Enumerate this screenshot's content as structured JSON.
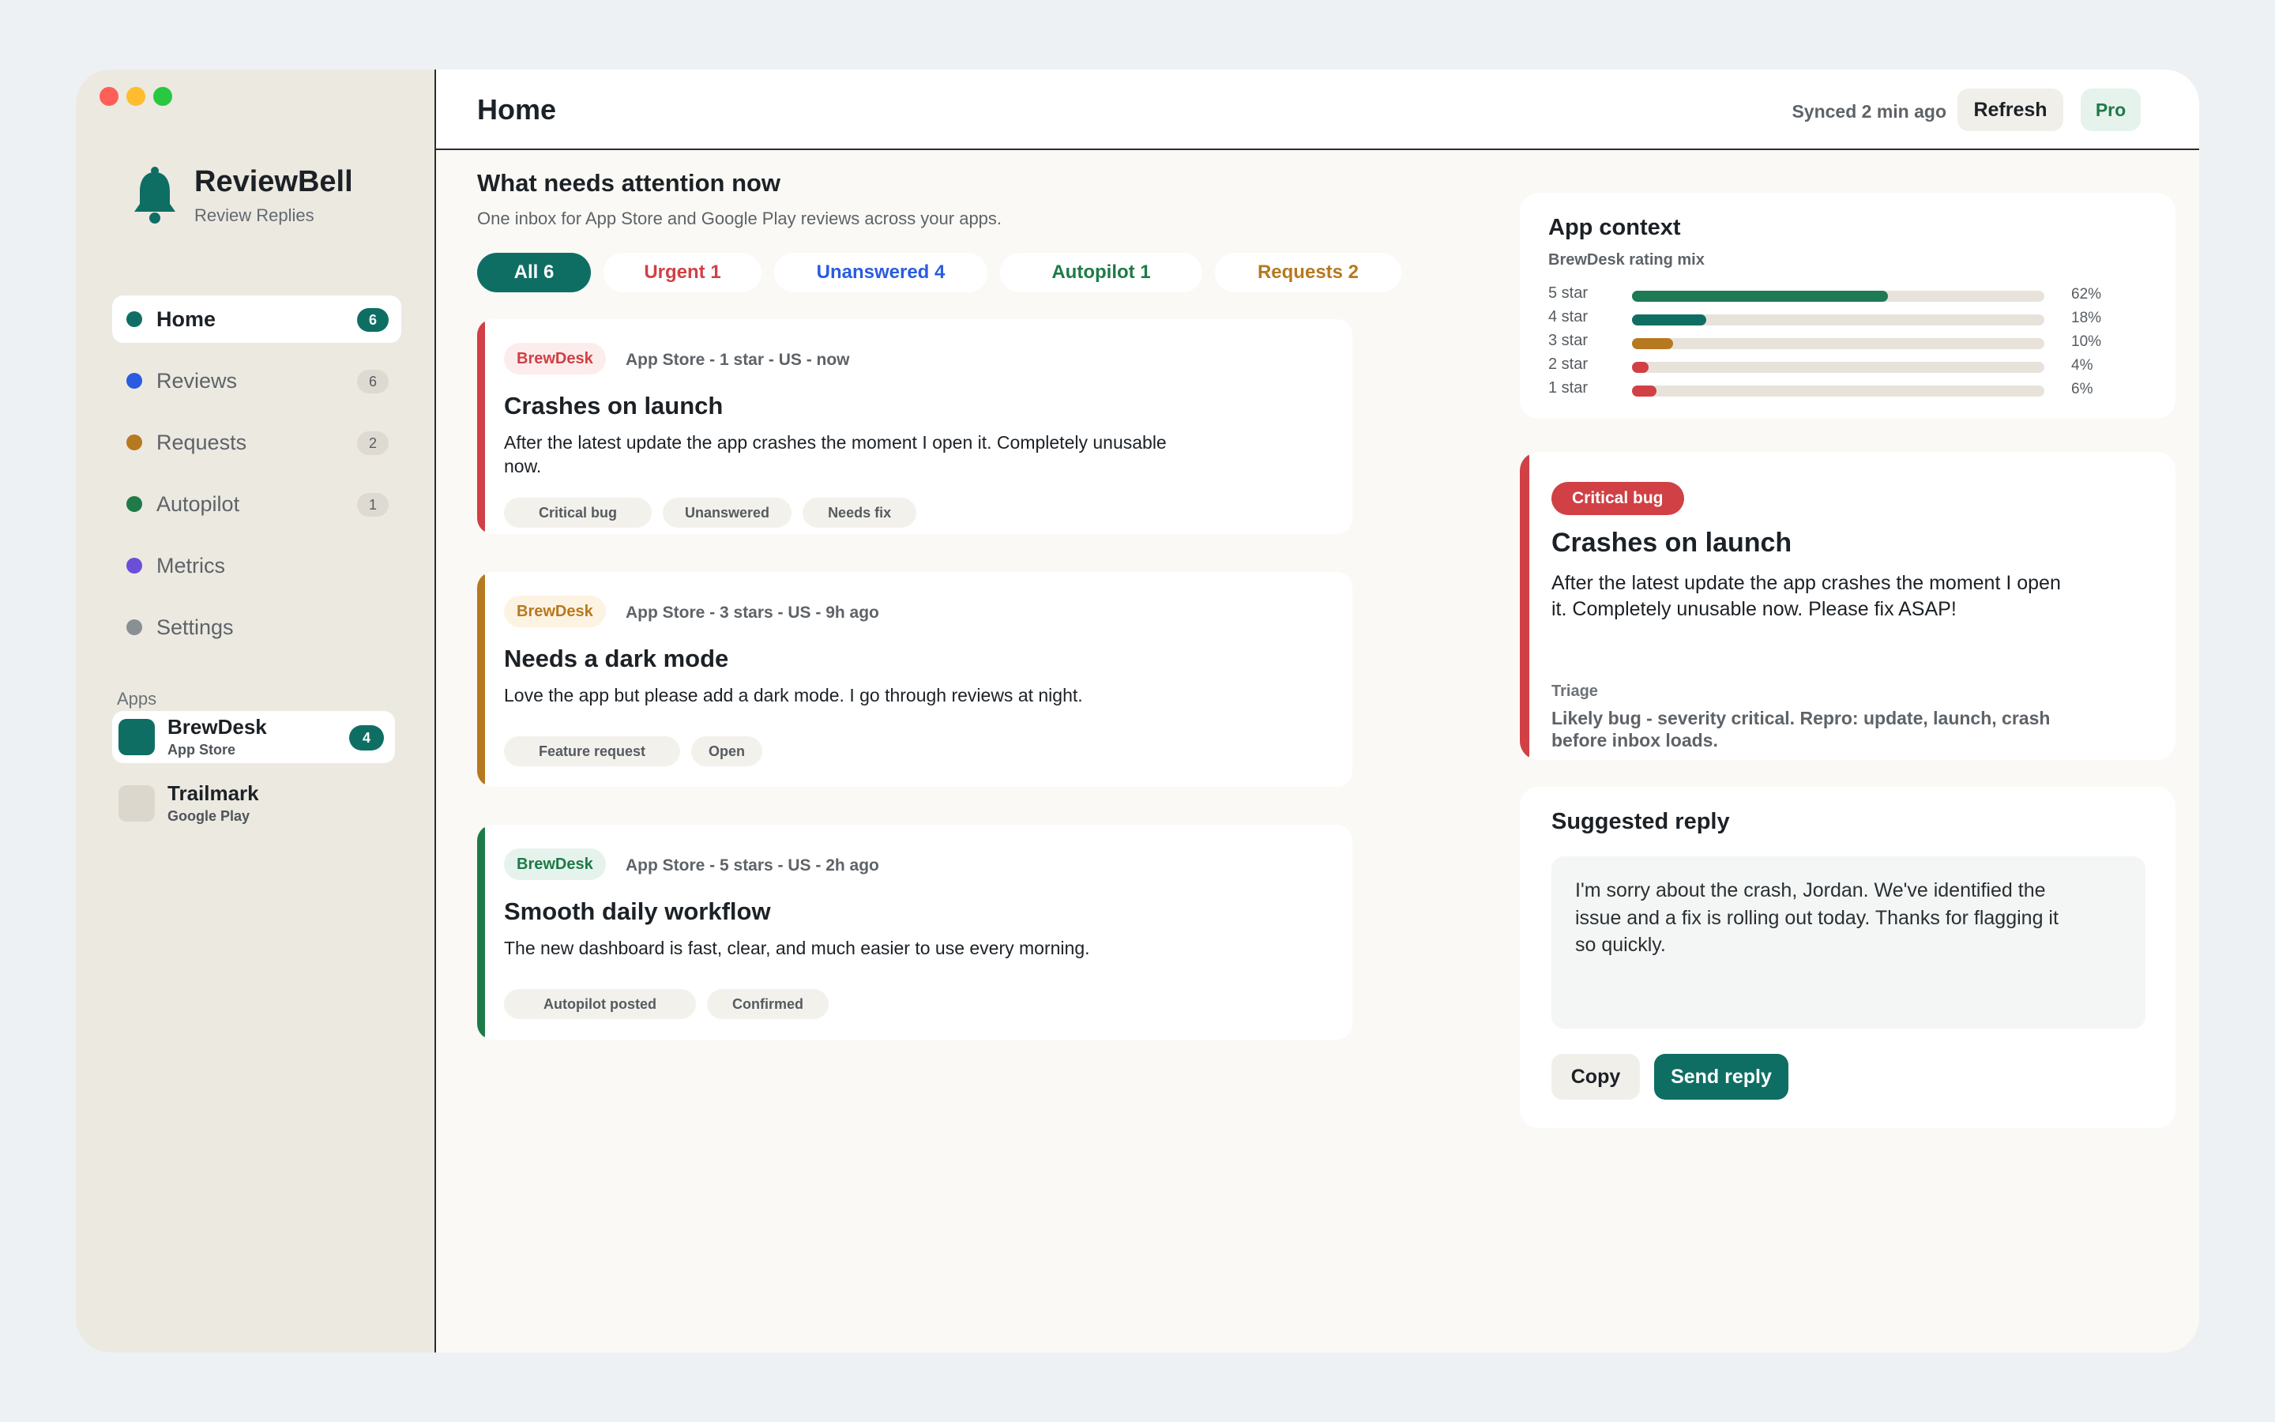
{
  "app": {
    "brand_name": "ReviewBell",
    "brand_sub": "Review Replies",
    "brand_icon": "bell-icon",
    "accent": "#0f6e64"
  },
  "sidebar": {
    "nav": [
      {
        "label": "Home",
        "count": "6",
        "color": "#0f6e64",
        "active": true
      },
      {
        "label": "Reviews",
        "count": "6",
        "color": "#2a5be0"
      },
      {
        "label": "Requests",
        "count": "2",
        "color": "#b7791f"
      },
      {
        "label": "Autopilot",
        "count": "1",
        "color": "#1e7a48"
      },
      {
        "label": "Metrics",
        "count": "",
        "color": "#6b4fd8"
      },
      {
        "label": "Settings",
        "count": "",
        "color": "#8a8f94"
      }
    ],
    "apps_label": "Apps",
    "apps": [
      {
        "name": "BrewDesk",
        "store": "App Store",
        "count": "4",
        "color": "#0f6e64",
        "active": true
      },
      {
        "name": "Trailmark",
        "store": "Google Play",
        "count": "",
        "color": "#dcd7cc"
      }
    ]
  },
  "header": {
    "title": "Home",
    "synced": "Synced 2 min ago",
    "refresh_label": "Refresh",
    "plan_badge": "Pro"
  },
  "main": {
    "section_title": "What needs attention now",
    "section_sub": "One inbox for App Store and Google Play reviews across your apps.",
    "filters": [
      {
        "label": "All 6",
        "color": "#ffffff",
        "active": true
      },
      {
        "label": "Urgent 1",
        "color": "#d04045"
      },
      {
        "label": "Unanswered 4",
        "color": "#2a5be0"
      },
      {
        "label": "Autopilot 1",
        "color": "#1e7a48"
      },
      {
        "label": "Requests 2",
        "color": "#b7791f"
      }
    ],
    "reviews": [
      {
        "app": "BrewDesk",
        "meta": "App Store - 1 star - US - now",
        "title": "Crashes on launch",
        "body": "After the latest update the app crashes the moment I open it. Completely unusable now.",
        "tags": [
          "Critical bug",
          "Unanswered",
          "Needs fix"
        ],
        "accent": "#d04045",
        "tag_bg": "#fdecec"
      },
      {
        "app": "BrewDesk",
        "meta": "App Store - 3 stars - US - 9h ago",
        "title": "Needs a dark mode",
        "body": "Love the app but please add a dark mode. I go through reviews at night.",
        "tags": [
          "Feature request",
          "Open"
        ],
        "accent": "#b7791f",
        "tag_bg": "#fdf3e3"
      },
      {
        "app": "BrewDesk",
        "meta": "App Store - 5 stars - US - 2h ago",
        "title": "Smooth daily workflow",
        "body": "The new dashboard is fast, clear, and much easier to use every morning.",
        "tags": [
          "Autopilot posted",
          "Confirmed"
        ],
        "accent": "#1e7a48",
        "tag_bg": "#e6f3ec"
      }
    ]
  },
  "context": {
    "title": "App context",
    "subtitle": "BrewDesk rating mix",
    "ratings": [
      {
        "label": "5 star",
        "pct": 62,
        "pct_text": "62%",
        "color": "#1e7a54"
      },
      {
        "label": "4 star",
        "pct": 18,
        "pct_text": "18%",
        "color": "#0f6e64"
      },
      {
        "label": "3 star",
        "pct": 10,
        "pct_text": "10%",
        "color": "#b7791f"
      },
      {
        "label": "2 star",
        "pct": 4,
        "pct_text": "4%",
        "color": "#d04045"
      },
      {
        "label": "1 star",
        "pct": 6,
        "pct_text": "6%",
        "color": "#d04045"
      }
    ]
  },
  "detail": {
    "badge": "Critical bug",
    "title": "Crashes on launch",
    "body": "After the latest update the app crashes the moment I open it. Completely unusable now. Please fix ASAP!",
    "triage_label": "Triage",
    "triage_text": "Likely bug - severity critical. Repro: update, launch, crash before inbox loads."
  },
  "reply": {
    "title": "Suggested reply",
    "text": "I'm sorry about the crash, Jordan. We've identified the issue and a fix is rolling out today. Thanks for flagging it so quickly.",
    "copy_label": "Copy",
    "send_label": "Send reply"
  }
}
